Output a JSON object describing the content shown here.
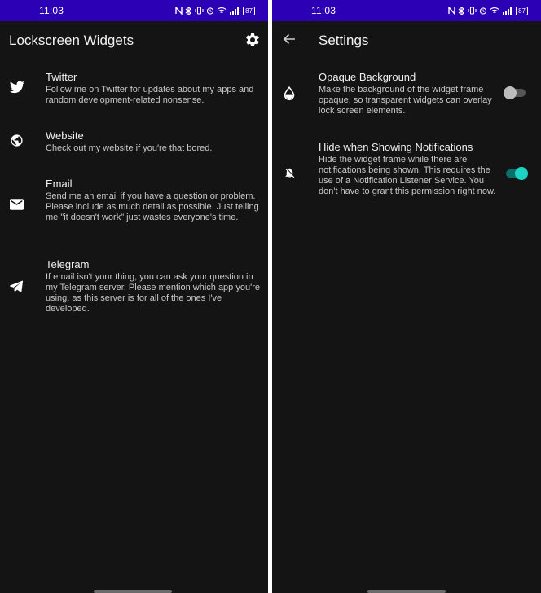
{
  "status": {
    "time": "11:03",
    "battery": "87"
  },
  "colors": {
    "statusbar": "#2c00b4",
    "background": "#141414",
    "switch_on_thumb": "#1dd3c4",
    "switch_on_track": "#0a6f68",
    "switch_off_thumb": "#bdbdbd"
  },
  "left": {
    "title": "Lockscreen Widgets",
    "settings_icon": "gear-icon",
    "items": [
      {
        "icon": "twitter-icon",
        "title": "Twitter",
        "desc": "Follow me on Twitter for updates about my apps and random development-related nonsense."
      },
      {
        "icon": "globe-icon",
        "title": "Website",
        "desc": "Check out my website if you're that bored."
      },
      {
        "icon": "email-icon",
        "title": "Email",
        "desc": "Send me an email if you have a question or problem. Please include as much detail as possible. Just telling me \"it doesn't work\" just wastes everyone's time."
      },
      {
        "icon": "telegram-icon",
        "title": "Telegram",
        "desc": "If email isn't your thing, you can ask your question in my Telegram server. Please mention which app you're using, as this server is for all of the ones I've developed."
      }
    ]
  },
  "right": {
    "title": "Settings",
    "back_icon": "back-arrow-icon",
    "prefs": [
      {
        "icon": "opacity-drop-icon",
        "title": "Opaque Background",
        "desc": "Make the background of the widget frame opaque, so transparent widgets can overlay lock screen elements.",
        "enabled": false
      },
      {
        "icon": "notifications-off-icon",
        "title": "Hide when Showing Notifications",
        "desc": "Hide the widget frame while there are notifications being shown. This requires the use of a Notification Listener Service. You don't have to grant this permission right now.",
        "enabled": true
      }
    ]
  }
}
